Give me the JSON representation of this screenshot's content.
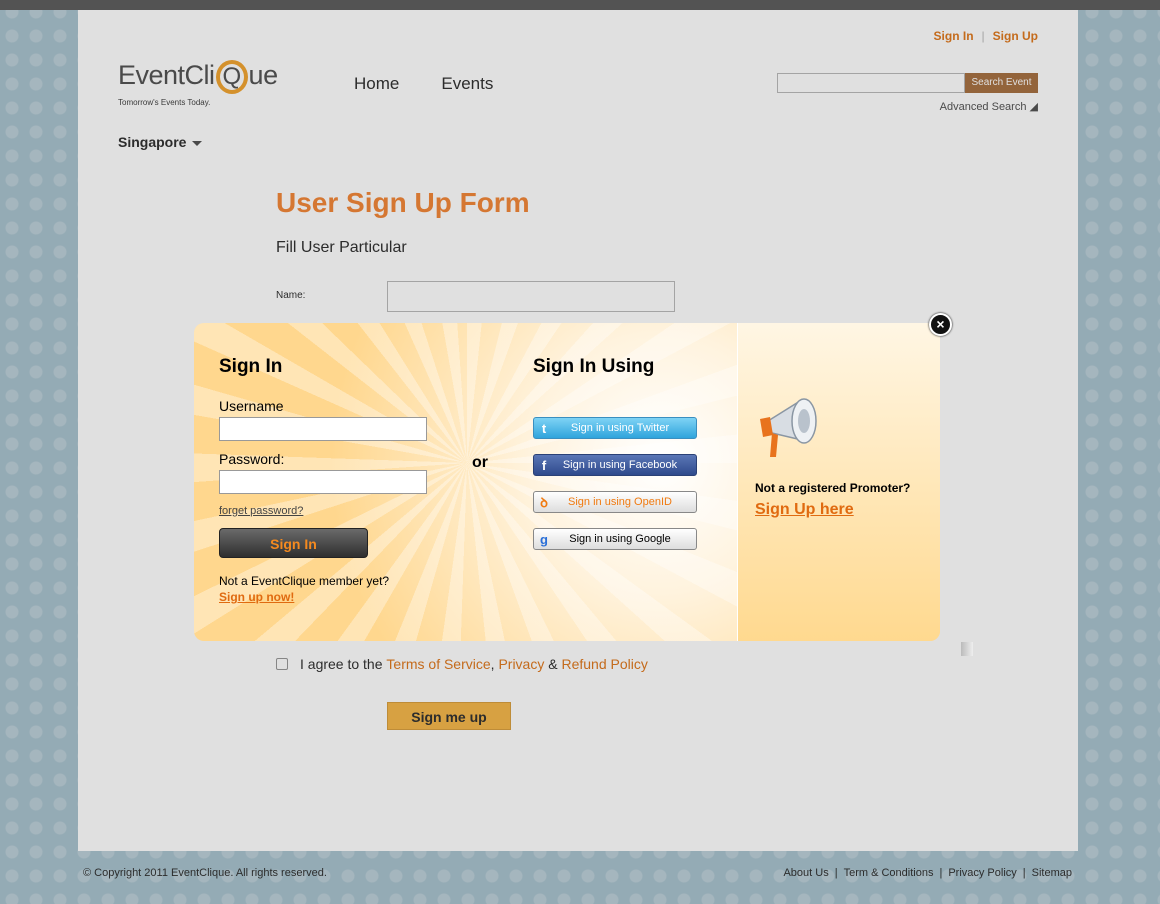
{
  "header": {
    "logo_word_before": "EventCli",
    "logo_q": "Q",
    "logo_word_after": "ue",
    "logo_tagline": "Tomorrow's Events Today.",
    "top_links": {
      "signin": "Sign In",
      "separator": "|",
      "signup": "Sign Up"
    },
    "nav": [
      "Home",
      "Events"
    ],
    "search": {
      "placeholder": "",
      "button": "Search Event",
      "advanced": "Advanced Search"
    },
    "city": "Singapore"
  },
  "form": {
    "title": "User Sign Up Form",
    "subtitle": "Fill User Particular",
    "name_label": "Name:",
    "agree": {
      "prefix": "I agree to the",
      "terms": "Terms of Service",
      "comma": ",",
      "privacy": "Privacy",
      "amp": "&",
      "refund": "Refund Policy"
    },
    "submit": "Sign me up"
  },
  "modal": {
    "signin_title": "Sign In",
    "username_label": "Username",
    "password_label": "Password:",
    "forget": "forget password?",
    "signin_button": "Sign In",
    "not_member": "Not a EventClique member yet?",
    "signup_now": "Sign up now!",
    "or": "or",
    "signin_using_title": "Sign In Using",
    "social": {
      "twitter": "Sign in using Twitter",
      "facebook": "Sign in using Facebook",
      "openid": "Sign in using OpenID",
      "google": "Sign in using Google"
    },
    "social_icons": {
      "twitter": "t",
      "facebook": "f",
      "openid": "ꝺ",
      "google": "g"
    },
    "not_registered": "Not a registered Promoter?",
    "signup_here": "Sign Up here",
    "close": "×"
  },
  "footer": {
    "copyright": "© Copyright 2011 EventClique. All rights reserved.",
    "links": [
      "About Us",
      "Term & Conditions",
      "Privacy Policy",
      "Sitemap"
    ],
    "separator": "|"
  },
  "colors": {
    "accent": "#f3883a",
    "link_orange": "#e07a20",
    "button_gold": "#f5b84c",
    "top_bar": "#5f5f5f",
    "background": "#a9c3ce"
  }
}
